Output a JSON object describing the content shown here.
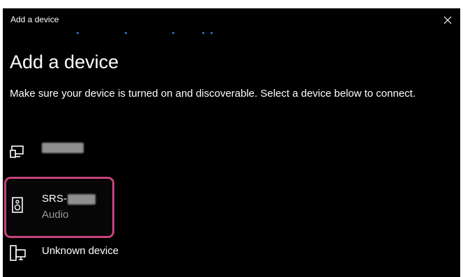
{
  "window": {
    "title": "Add a device",
    "close_icon": "close-icon"
  },
  "page": {
    "heading": "Add a device",
    "instruction": "Make sure your device is turned on and discoverable. Select a device below to connect."
  },
  "devices": [
    {
      "icon": "display-icon",
      "name": "",
      "subtitle": ""
    },
    {
      "icon": "speaker-icon",
      "name": "SRS-",
      "subtitle": "Audio",
      "highlighted": true
    },
    {
      "icon": "computer-icon",
      "name": "Unknown device",
      "subtitle": ""
    }
  ],
  "colors": {
    "background": "#000000",
    "text": "#ffffff",
    "secondary_text": "#9a9a9a",
    "highlight_border": "#c7437f",
    "progress_dots": "#2f7bd8"
  }
}
